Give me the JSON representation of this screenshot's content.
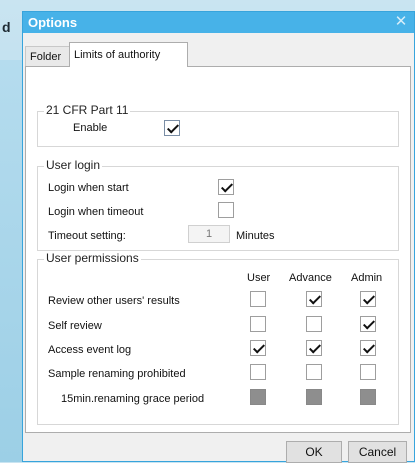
{
  "background": {
    "fragment_text": "d"
  },
  "dialog": {
    "title": "Options",
    "close_glyph": "✕",
    "tabs": [
      {
        "label": "Folder"
      },
      {
        "label": "Limits of authority"
      }
    ],
    "cfr": {
      "legend": "21 CFR Part 11",
      "enable_label": "Enable",
      "enable_checked": true
    },
    "user_login": {
      "legend": "User login",
      "login_start_label": "Login when start",
      "login_start_checked": true,
      "login_timeout_label": "Login when timeout",
      "login_timeout_checked": false,
      "timeout_label": "Timeout setting:",
      "timeout_value": "1",
      "timeout_unit": "Minutes"
    },
    "permissions": {
      "legend": "User permissions",
      "columns": [
        "User",
        "Advance",
        "Admin"
      ],
      "rows": [
        {
          "label": "Review other users' results",
          "values": [
            false,
            true,
            true
          ]
        },
        {
          "label": "Self review",
          "values": [
            false,
            false,
            true
          ]
        },
        {
          "label": "Access event log",
          "values": [
            true,
            true,
            true
          ]
        },
        {
          "label": "Sample renaming prohibited",
          "values": [
            false,
            false,
            false
          ]
        },
        {
          "label": "15min.renaming grace period",
          "values": [
            false,
            false,
            false
          ],
          "disabled": true
        }
      ]
    },
    "buttons": {
      "ok": "OK",
      "cancel": "Cancel"
    }
  }
}
